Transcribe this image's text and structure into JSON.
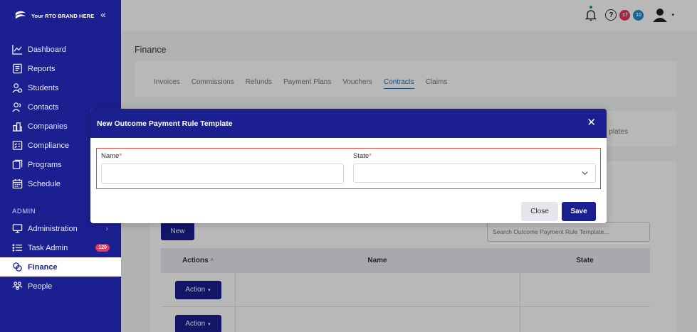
{
  "brand": {
    "name": "Your RTO BRAND HERE",
    "collapse_glyph": "«"
  },
  "sidebar": {
    "items": [
      {
        "label": "Dashboard",
        "icon": "chart-line-icon"
      },
      {
        "label": "Reports",
        "icon": "report-icon"
      },
      {
        "label": "Students",
        "icon": "students-icon"
      },
      {
        "label": "Contacts",
        "icon": "contacts-icon"
      },
      {
        "label": "Companies",
        "icon": "companies-icon"
      },
      {
        "label": "Compliance",
        "icon": "compliance-icon"
      },
      {
        "label": "Programs",
        "icon": "programs-icon"
      },
      {
        "label": "Schedule",
        "icon": "calendar-icon"
      }
    ],
    "section_admin": "ADMIN",
    "admin_items": [
      {
        "label": "Administration",
        "icon": "monitor-icon",
        "chevron": "›"
      },
      {
        "label": "Task Admin",
        "icon": "list-icon",
        "badge": "120"
      },
      {
        "label": "Finance",
        "icon": "finance-icon",
        "active": true
      },
      {
        "label": "People",
        "icon": "people-icon"
      }
    ]
  },
  "topbar": {
    "help_glyph": "?",
    "badge_red": "17",
    "badge_blue": "10",
    "avatar_caret": "▾"
  },
  "page": {
    "title": "Finance",
    "tabs": [
      "Invoices",
      "Commissions",
      "Refunds",
      "Payment Plans",
      "Vouchers",
      "Contracts",
      "Claims"
    ],
    "active_tab": "Contracts",
    "sub_label_partial": "plates"
  },
  "list": {
    "new_label": "New",
    "search_placeholder": "Search Outcome Payment Rule Template...",
    "columns": {
      "actions": "Actions",
      "actions_sort": "^",
      "name": "Name",
      "state": "State"
    },
    "action_label": "Action",
    "action_caret": "▾"
  },
  "modal": {
    "title": "New Outcome Payment Rule Template",
    "close_glyph": "✕",
    "name_label": "Name",
    "state_label": "State",
    "required_mark": "*",
    "name_value": "",
    "state_value": "",
    "close_label": "Close",
    "save_label": "Save"
  },
  "colors": {
    "brand": "#1b1f8f",
    "accent_tab": "#1e6fb3",
    "required": "#e04848",
    "badge_red": "#e03a5c",
    "badge_blue": "#1e8fd6"
  }
}
